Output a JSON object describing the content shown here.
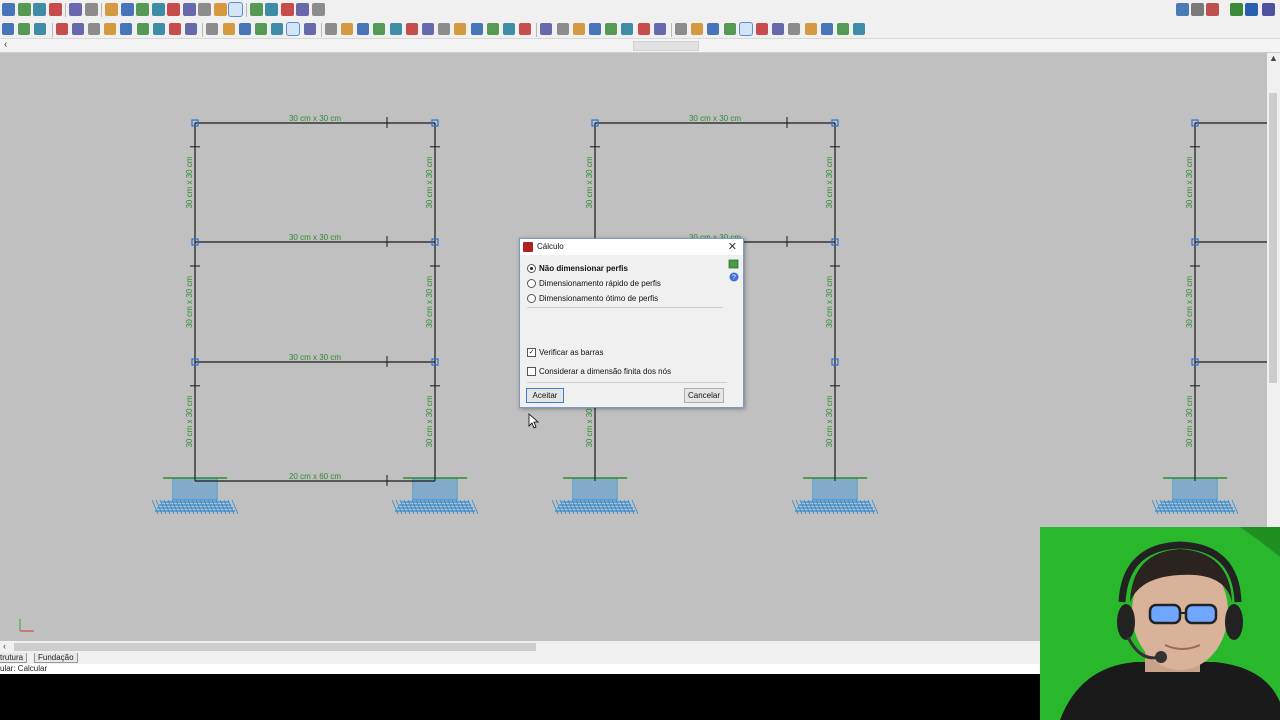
{
  "toolbar_icons": [
    "save-icon",
    "print-icon",
    "grid-icon",
    "magnet-icon",
    "undo-icon",
    "redo-icon",
    "zoom-window-icon",
    "zoom-all-icon",
    "zoom-in-icon",
    "zoom-out-icon",
    "zoom-previous-icon",
    "pan-icon",
    "refresh-icon",
    "view-3d-icon",
    "rotate-icon",
    "pick-icon",
    "select-icon",
    "snap-icon",
    "mirror-icon",
    "wrench-icon",
    "bars-icon"
  ],
  "canvas": {
    "background": "#c0c0c0",
    "frames": [
      {
        "beams": [
          {
            "label": "30 cm x 30 cm"
          },
          {
            "label": "30 cm x 30 cm"
          },
          {
            "label": "30 cm x 30 cm"
          },
          {
            "label": "20 cm x 60 cm"
          }
        ],
        "column_label": "30 cm x 30 cm"
      },
      {
        "beams": [
          {
            "label": "30 cm x 30 cm"
          },
          {
            "label": "30 cm x 30 cm"
          }
        ],
        "column_label": "30 cm x 30 cm"
      },
      {
        "column_label": "30 cm x 30 cm"
      }
    ]
  },
  "dialog": {
    "title": "Cálculo",
    "options": [
      {
        "label": "Não dimensionar perfis",
        "selected": true
      },
      {
        "label": "Dimensionamento rápido de perfis",
        "selected": false
      },
      {
        "label": "Dimensionamento ótimo de perfis",
        "selected": false
      }
    ],
    "checks": [
      {
        "label": "Verificar as barras",
        "checked": true
      },
      {
        "label": "Considerar a dimensão finita dos nós",
        "checked": false
      }
    ],
    "accept": "Aceitar",
    "cancel": "Cancelar"
  },
  "tabs": [
    "trutura",
    "Fundação"
  ],
  "status_text": "ular: Calcular",
  "colors": {
    "member": "#1a1a1a",
    "label": "#2e8b2e",
    "node": "#2f6fd1",
    "foundation": "#2a8cd8",
    "webcam_bg": "#29b82c"
  }
}
